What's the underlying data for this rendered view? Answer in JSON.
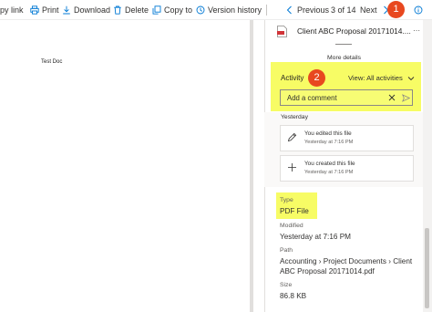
{
  "toolbar": {
    "copy_link": "py link",
    "print": "Print",
    "download": "Download",
    "delete": "Delete",
    "copy_to": "Copy to",
    "version_history": "Version history",
    "previous": "Previous",
    "position": "3 of 14",
    "next": "Next"
  },
  "annotations": {
    "badge1": "1",
    "badge2": "2"
  },
  "document": {
    "text": "Test Doc"
  },
  "details": {
    "file_name": "Client ABC Proposal 20171014....",
    "more": "⋯",
    "more_details": "More details",
    "activity": {
      "title": "Activity",
      "filter": "View: All activities",
      "comment_placeholder": "Add a comment",
      "group": "Yesterday",
      "items": [
        {
          "icon": "pencil-icon",
          "text": "You edited this file",
          "time": "Yesterday at 7:16 PM"
        },
        {
          "icon": "plus-icon",
          "text": "You created this file",
          "time": "Yesterday at 7:16 PM"
        }
      ]
    },
    "properties": {
      "type_label": "Type",
      "type_value": "PDF File",
      "modified_label": "Modified",
      "modified_value": "Yesterday at 7:16 PM",
      "path_label": "Path",
      "path_line1": "Accounting › Project Documents › Client",
      "path_line2": "ABC Proposal 20171014.pdf",
      "size_label": "Size",
      "size_value": "86.8 KB"
    }
  },
  "colors": {
    "highlight": "#f6fb4a",
    "badge": "#e8481f",
    "pdf": "#d13438"
  }
}
